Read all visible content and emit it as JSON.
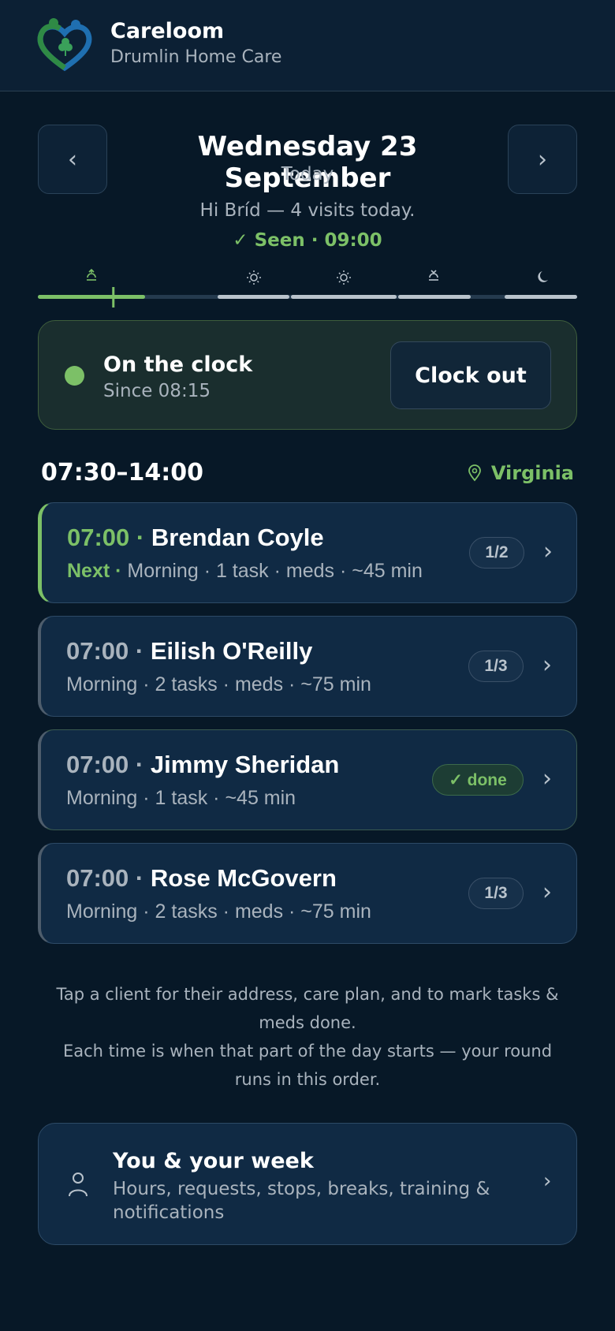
{
  "app": {
    "name": "Careloom",
    "org": "Drumlin Home Care"
  },
  "date_nav": {
    "prev_label": "‹",
    "next_label": "›",
    "title": "Wednesday 23 September",
    "subtitle": "Today"
  },
  "greeting": "Hi Bríd — 4 visits today.",
  "seen": "✓ Seen · 09:00",
  "timeline": {
    "icons": [
      "sunrise-icon",
      "sun-icon",
      "sun-icon",
      "sunset-icon",
      "moon-icon"
    ],
    "current_position": 0.14,
    "colors": {
      "active": "#7cc067",
      "segment": "#b9c3cc",
      "track": "#243a4e"
    }
  },
  "clock": {
    "title": "On the clock",
    "since": "Since 08:15",
    "button_label": "Clock out"
  },
  "shift": {
    "time_range": "07:30–14:00",
    "area": "Virginia"
  },
  "visits": [
    {
      "time": "07:00",
      "separator": "·",
      "name": "Brendan Coyle",
      "next_tag": "Next ·",
      "details": "Morning · 1 task · meds · ~45 min",
      "badge": "1/2",
      "chevron": "›"
    },
    {
      "time": "07:00",
      "separator": "·",
      "name": "Eilish O'Reilly",
      "details": "Morning · 2 tasks · meds · ~75 min",
      "badge": "1/3",
      "chevron": "›"
    },
    {
      "time": "07:00",
      "separator": "·",
      "name": "Jimmy Sheridan",
      "details": "Morning · 1 task · ~45 min",
      "badge": "✓ done",
      "chevron": "›"
    },
    {
      "time": "07:00",
      "separator": "·",
      "name": "Rose McGovern",
      "details": "Morning · 2 tasks · meds · ~75 min",
      "badge": "1/3",
      "chevron": "›"
    }
  ],
  "help": {
    "line1": "Tap a client for their address, care plan, and to mark tasks & meds done.",
    "line2": "Each time is when that part of the day starts — your round runs in this order."
  },
  "week": {
    "title": "You & your week",
    "description": "Hours, requests, stops, breaks, training & notifications",
    "chevron": "›"
  },
  "colors": {
    "background": "#071827",
    "accent": "#7cc067",
    "card": "#102a44"
  }
}
